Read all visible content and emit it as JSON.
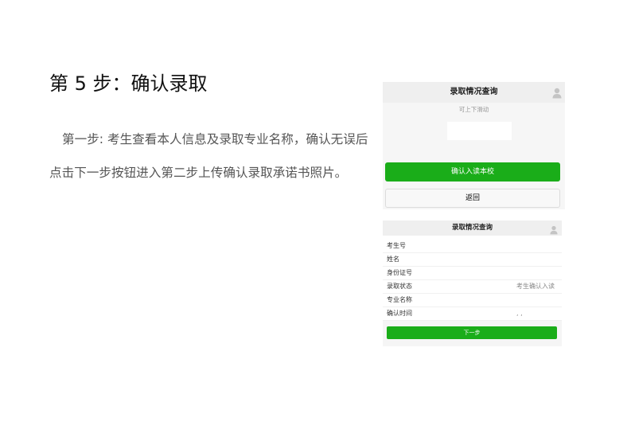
{
  "title": "第 5 步：确认录取",
  "paragraph": {
    "line1": "第一步: 考生查看本人信息及录取专业名称，确认无误后",
    "line2": "点击下一步按钮进入第二步上传确认录取承诺书照片。"
  },
  "screen1": {
    "header_title": "录取情况查询",
    "user_icon": "user-icon",
    "scroll_hint": "可上下滑动",
    "confirm_button": "确认入读本校",
    "back_button": "返回"
  },
  "screen2": {
    "header_title": "录取情况查询",
    "user_icon": "user-icon",
    "rows": [
      {
        "label": "考生号"
      },
      {
        "label": "姓名"
      },
      {
        "label": "身份证号"
      },
      {
        "label": "录取状态",
        "value": "考生确认入读"
      },
      {
        "label": "专业名称"
      },
      {
        "label": "确认时间",
        "value": ", ,"
      }
    ],
    "next_button": "下一步"
  },
  "colors": {
    "accent_green": "#1aad19",
    "header_gray": "#efefef",
    "body_text_gray": "#555555",
    "icon_gray": "#c4c4c4"
  }
}
